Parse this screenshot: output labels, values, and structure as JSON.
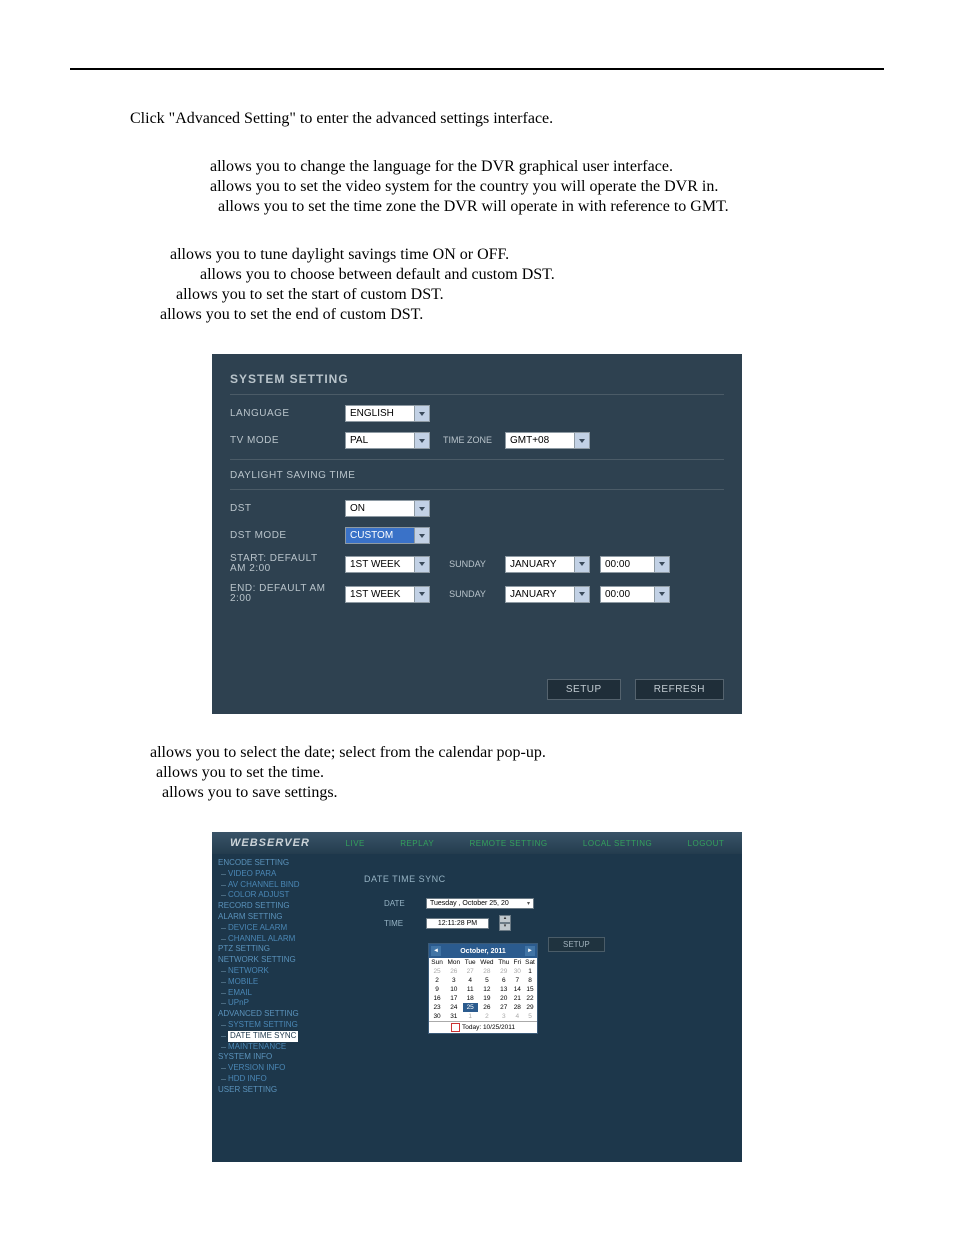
{
  "intro": "Click \"Advanced Setting\" to enter the advanced settings interface.",
  "features1": {
    "language": "allows you to change the language for the DVR graphical user interface.",
    "tvmode": "allows you to set the video system for the country you will operate the DVR in.",
    "timezone": "allows you to set the time zone the DVR will operate in with reference to GMT."
  },
  "features2": {
    "dst": "allows you to tune daylight savings time ON or OFF.",
    "dstmode": "allows you to choose between default and custom DST.",
    "start": "allows you to set the start of custom DST.",
    "end": "allows you to set the end of custom DST."
  },
  "panel": {
    "title": "SYSTEM SETTING",
    "language_label": "LANGUAGE",
    "language_value": "ENGLISH",
    "tvmode_label": "TV MODE",
    "tvmode_value": "PAL",
    "timezone_label": "TIME ZONE",
    "timezone_value": "GMT+08",
    "section": "DAYLIGHT SAVING TIME",
    "dst_label": "DST",
    "dst_value": "ON",
    "dstmode_label": "DST MODE",
    "dstmode_value": "CUSTOM",
    "start_label": "START: DEFAULT AM 2:00",
    "end_label": "END: DEFAULT AM 2:00",
    "week_value": "1ST WEEK",
    "day_value": "SUNDAY",
    "month_value": "JANUARY",
    "hour_value": "00:00",
    "setup": "SETUP",
    "refresh": "REFRESH"
  },
  "features3": {
    "date": "allows you to select the date; select from the calendar pop-up.",
    "time": "allows you to set the time.",
    "setup": "allows you to save settings."
  },
  "web": {
    "logo": "WEBSERVER",
    "tabs": [
      "LIVE",
      "REPLAY",
      "REMOTE SETTING",
      "LOCAL SETTING",
      "LOGOUT"
    ],
    "tree": {
      "encode": "ENCODE SETTING",
      "video": "VIDEO PARA",
      "avbind": "AV CHANNEL BIND",
      "color": "COLOR ADJUST",
      "record": "RECORD SETTING",
      "alarm": "ALARM SETTING",
      "devalarm": "DEVICE ALARM",
      "chalarm": "CHANNEL ALARM",
      "ptz": "PTZ SETTING",
      "netset": "NETWORK SETTING",
      "network": "NETWORK",
      "mobile": "MOBILE",
      "email": "EMAIL",
      "upnp": "UPnP",
      "adv": "ADVANCED SETTING",
      "system": "SYSTEM SETTING",
      "dtsync": "DATE TIME SYNC",
      "maint": "MAINTENANCE",
      "sysinfo": "SYSTEM INFO",
      "ver": "VERSION INFO",
      "hdd": "HDD INFO",
      "user": "USER SETTING"
    },
    "main": {
      "title": "DATE TIME SYNC",
      "date_label": "DATE",
      "date_value": "Tuesday , October 25, 20",
      "time_label": "TIME",
      "time_value": "12:11:28 PM",
      "setup": "SETUP",
      "cal": {
        "month": "October, 2011",
        "dow": [
          "Sun",
          "Mon",
          "Tue",
          "Wed",
          "Thu",
          "Fri",
          "Sat"
        ],
        "rows": [
          [
            "25",
            "26",
            "27",
            "28",
            "29",
            "30",
            "1"
          ],
          [
            "2",
            "3",
            "4",
            "5",
            "6",
            "7",
            "8"
          ],
          [
            "9",
            "10",
            "11",
            "12",
            "13",
            "14",
            "15"
          ],
          [
            "16",
            "17",
            "18",
            "19",
            "20",
            "21",
            "22"
          ],
          [
            "23",
            "24",
            "25",
            "26",
            "27",
            "28",
            "29"
          ],
          [
            "30",
            "31",
            "1",
            "2",
            "3",
            "4",
            "5"
          ]
        ],
        "today": "Today: 10/25/2011"
      }
    }
  }
}
